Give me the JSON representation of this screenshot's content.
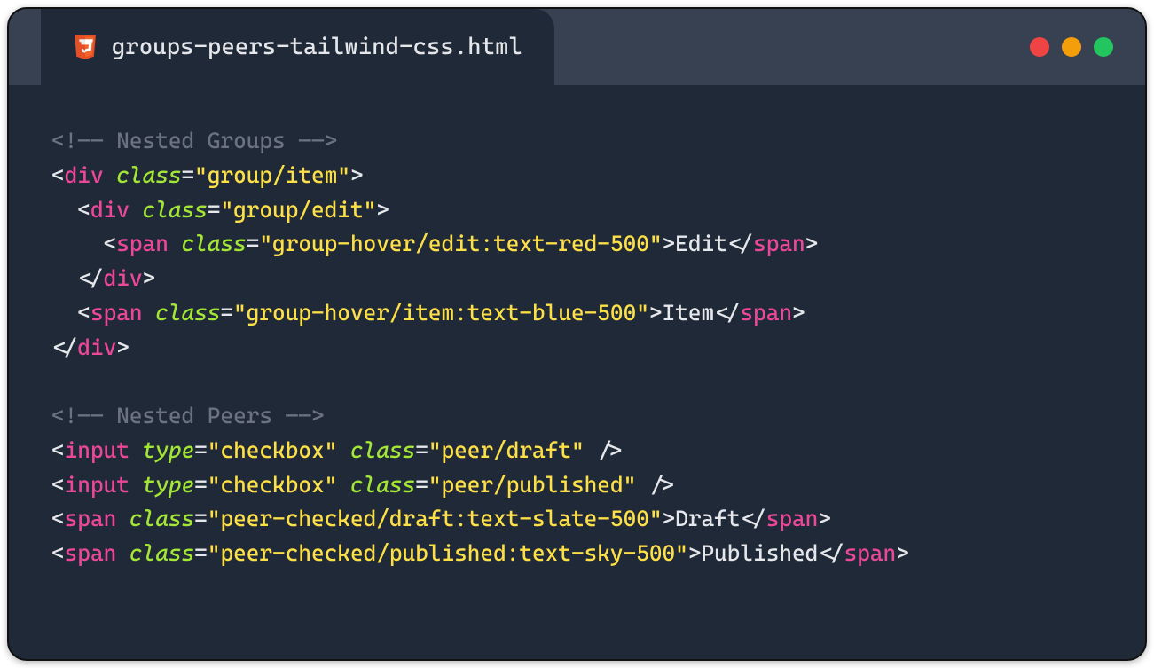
{
  "tab": {
    "title": "groups-peers-tailwind-css.html"
  },
  "code": {
    "comment1": "<!—— Nested Groups ——>",
    "tag_div": "div",
    "tag_span": "span",
    "tag_input": "input",
    "attr_class": "class",
    "attr_type": "type",
    "val_group_item": "\"group/item\"",
    "val_group_edit": "\"group/edit\"",
    "val_ghover_edit": "\"group-hover/edit:text-red-500\"",
    "txt_edit": "Edit",
    "val_ghover_item": "\"group-hover/item:text-blue-500\"",
    "txt_item": "Item",
    "comment2": "<!—— Nested Peers ——>",
    "val_checkbox": "\"checkbox\"",
    "val_peer_draft": "\"peer/draft\"",
    "val_peer_published": "\"peer/published\"",
    "val_pchecked_draft": "\"peer-checked/draft:text-slate-500\"",
    "txt_draft": "Draft",
    "val_pchecked_published": "\"peer-checked/published:text-sky-500\"",
    "txt_published": "Published",
    "lt": "<",
    "gt": ">",
    "lts": "</",
    "sgt": "/>",
    "eq": "="
  }
}
